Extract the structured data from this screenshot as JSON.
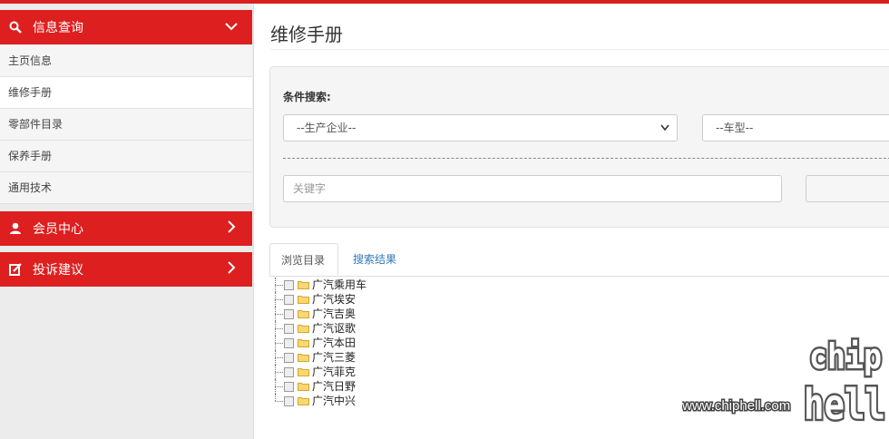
{
  "sidebar": {
    "info": {
      "label": "信息查询",
      "icon": "search-icon",
      "arrow": "chevron-down-icon"
    },
    "info_items": [
      {
        "label": "主页信息",
        "active": false
      },
      {
        "label": "维修手册",
        "active": true
      },
      {
        "label": "零部件目录",
        "active": false
      },
      {
        "label": "保养手册",
        "active": false
      },
      {
        "label": "通用技术",
        "active": false
      }
    ],
    "member": {
      "label": "会员中心",
      "icon": "user-icon",
      "arrow": "chevron-right-icon"
    },
    "complaint": {
      "label": "投诉建议",
      "icon": "edit-icon",
      "arrow": "chevron-right-icon"
    }
  },
  "main": {
    "title": "维修手册",
    "search": {
      "label": "条件搜索:",
      "company_select": "--生产企业--",
      "model_select": "--车型--",
      "keyword_placeholder": "关键字"
    },
    "tabs": [
      {
        "label": "浏览目录",
        "active": true
      },
      {
        "label": "搜索结果",
        "active": false
      }
    ],
    "tree": [
      "广汽乘用车",
      "广汽埃安",
      "广汽吉奥",
      "广汽讴歌",
      "广汽本田",
      "广汽三菱",
      "广汽菲克",
      "广汽日野",
      "广汽中兴"
    ]
  },
  "watermark": {
    "url": "www.chiphell.com",
    "logo_top": "chip",
    "logo_bottom": "hell"
  },
  "colors": {
    "accent": "#dd1f1f",
    "link": "#337ab7",
    "sidebar_bg": "#ececec"
  }
}
